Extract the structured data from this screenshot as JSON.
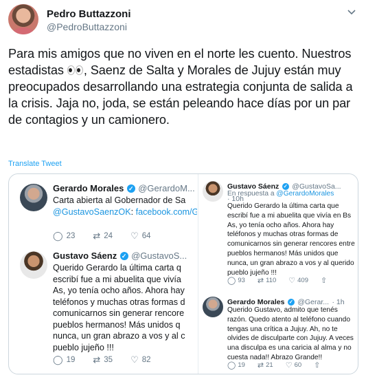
{
  "tweet": {
    "author_name": "Pedro Buttazzoni",
    "author_handle": "@PedroButtazzoni",
    "more_icon": "chevron-down-icon",
    "text_before_emoji": "Para mis amigos que no viven en el norte les cuento. Nuestros estadistas ",
    "emoji_name": "eyes-emoji",
    "text_after_emoji": ", Saenz de Salta y Morales de Jujuy están muy preocupados desarrollando una estrategia conjunta de salida a la crisis. Jaja no, joda, se están peleando hace días por un par de contagios y un camionero.",
    "translate_label": "Translate Tweet"
  },
  "media": {
    "left": {
      "morales": {
        "name": "Gerardo Morales",
        "handle": "@GerardoM...",
        "body_line1": "Carta abierta al Gobernador de Sa",
        "link1": "@GustavoSaenzOK",
        "link_sep": ": ",
        "link2": "facebook.com/GobernadorGera...",
        "replies": "23",
        "retweets": "24",
        "likes": "64"
      },
      "saenz": {
        "name": "Gustavo Sáenz",
        "handle": "@GustavoS...",
        "body": "Querido Gerardo la última carta q\nescribí fue a mi abuelita que vivía\nAs, yo tenía ocho años. Ahora hay\nteléfonos y muchas otras formas d\ncomunicarnos sin generar rencore\npueblos hermanos! Más unidos q\nnunca, un gran abrazo a vos y al c\npueblo jujeño !!!",
        "replies": "19",
        "retweets": "35",
        "likes": "82"
      }
    },
    "right": {
      "saenz": {
        "name": "Gustavo Sáenz",
        "handle": "@GustavoSa...",
        "time": "· 10h",
        "reply_prefix": "En respuesta a ",
        "reply_to": "@GerardoMorales",
        "body": "Querido Gerardo la última carta que\nescribí fue a mi abuelita que vivía en Bs\nAs, yo tenía ocho años. Ahora hay\nteléfonos y muchas otras formas de\ncomunicarnos sin generar rencores entre\npueblos hermanos! Más unidos que\nnunca, un gran abrazo a vos y al querido\npueblo jujeño !!!",
        "replies": "93",
        "retweets": "110",
        "likes": "409"
      },
      "morales": {
        "name": "Gerardo Morales",
        "handle": "@Gerar...",
        "time": "· 1h",
        "body": "Querido Gustavo, admito que tenés\nrazón. Quedo atento al teléfono cuando\ntengas una crítica a Jujuy. Ah, no te\nolvides de disculparte con Jujuy. A veces\nuna disculpa es una caricia al alma y no\ncuesta nada!! Abrazo Grande!!",
        "replies": "19",
        "retweets": "21",
        "likes": "60"
      }
    }
  },
  "icons": {
    "reply": "reply-icon",
    "retweet": "retweet-icon",
    "like": "heart-icon",
    "share": "share-icon",
    "verified": "verified-badge-icon"
  },
  "colors": {
    "link": "#1da1f2",
    "text": "#14171a",
    "muted": "#657786",
    "border": "#ccd6dd"
  }
}
